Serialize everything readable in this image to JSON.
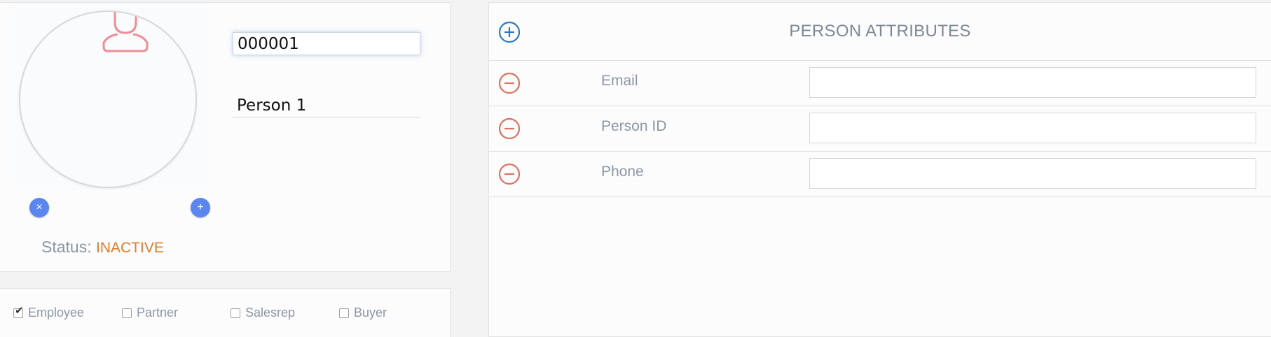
{
  "profile": {
    "id_value": "000001",
    "name_value": "Person 1",
    "status_label": "Status:",
    "status_value": "INACTIVE",
    "avatar_remove_glyph": "×",
    "avatar_add_glyph": "+",
    "placeholder_icon": "person-icon"
  },
  "roles": [
    {
      "label": "Employee",
      "checked": true
    },
    {
      "label": "Partner",
      "checked": false
    },
    {
      "label": "Salesrep",
      "checked": false
    },
    {
      "label": "Buyer",
      "checked": false
    }
  ],
  "attributes": {
    "title": "PERSON ATTRIBUTES",
    "add_icon": "plus-circle-icon",
    "remove_icon": "minus-circle-icon",
    "rows": [
      {
        "label": "Email",
        "value": ""
      },
      {
        "label": "Person ID",
        "value": ""
      },
      {
        "label": "Phone",
        "value": ""
      }
    ]
  },
  "colors": {
    "accent_blue": "#5b86f0",
    "add_icon_blue": "#2f78c4",
    "remove_icon_red": "#e07060",
    "status_orange": "#e07b2a",
    "avatar_pink": "#f08c98"
  }
}
